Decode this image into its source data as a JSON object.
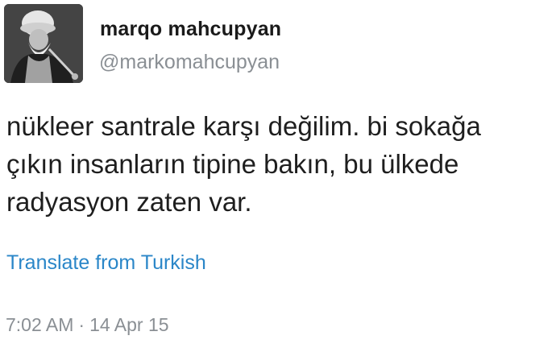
{
  "user": {
    "display_name": "marqo mahcupyan",
    "handle": "@markomahcupyan"
  },
  "tweet": {
    "lines": [
      "nükleer santrale karşı değilim. bi sokağa",
      "çıkın insanların tipine bakın, bu ülkede",
      "radyasyon zaten var."
    ],
    "translate_label": "Translate from Turkish",
    "time": "7:02 AM",
    "separator": "·",
    "date": "14 Apr 15"
  },
  "colors": {
    "link": "#2a86c8",
    "secondary_text": "#8a8f94",
    "primary_text": "#1a1a1a"
  }
}
